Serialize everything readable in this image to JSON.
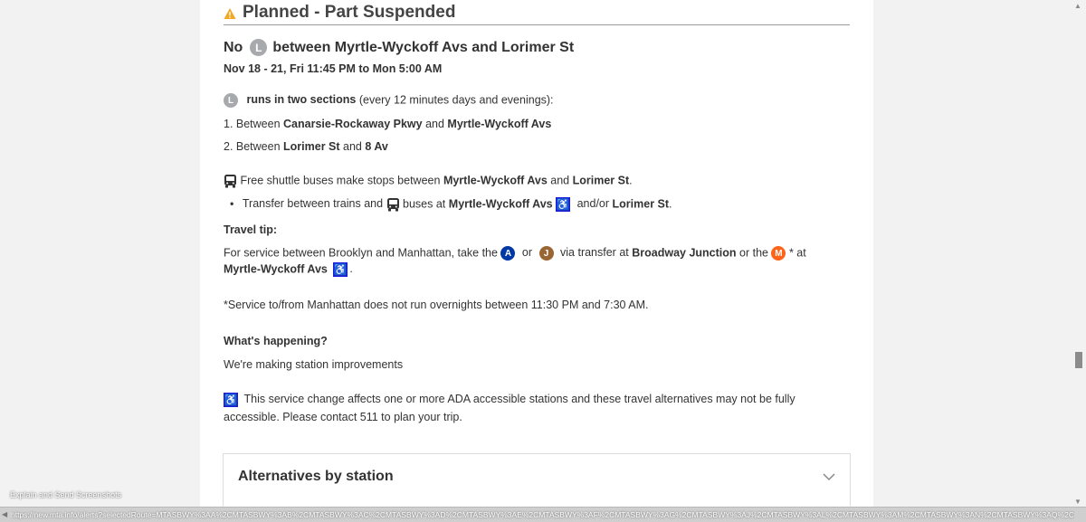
{
  "status": {
    "title": "Planned - Part Suspended",
    "warning_color": "#f5a623"
  },
  "alert": {
    "title_prefix": "No",
    "line": "L",
    "title_suffix": "between Myrtle-Wyckoff Avs and Lorimer St",
    "dates": "Nov 18 - 21, Fri 11:45 PM to Mon 5:00 AM"
  },
  "sections": {
    "runs_bold": "runs in two sections",
    "runs_rest": "(every 12 minutes days and evenings):",
    "item1_prefix": "1. Between",
    "item1_a": "Canarsie-Rockaway Pkwy",
    "item1_and": "and",
    "item1_b": "Myrtle-Wyckoff Avs",
    "item2_prefix": "2. Between",
    "item2_a": "Lorimer St",
    "item2_and": "and",
    "item2_b": "8 Av"
  },
  "shuttle": {
    "text": "Free shuttle buses make stops between",
    "stop_a": "Myrtle-Wyckoff Avs",
    "and": "and",
    "stop_b": "Lorimer St",
    "period": ".",
    "bullet": "•",
    "transfer_text": "Transfer between trains and",
    "buses_at": "buses at",
    "transfer_a": "Myrtle-Wyckoff Avs",
    "andor": "and/or",
    "transfer_b": "Lorimer St"
  },
  "travel_tip": {
    "heading": "Travel tip:",
    "text1": "For service between Brooklyn and Manhattan, take the",
    "line_a": "A",
    "or": "or",
    "line_j": "J",
    "via": "via transfer at",
    "junction": "Broadway Junction",
    "or_the": "or the",
    "line_m": "M",
    "at": "* at",
    "station": "Myrtle-Wyckoff Avs",
    "period": ".",
    "footnote": "*Service to/from Manhattan does not run overnights between 11:30 PM and 7:30 AM."
  },
  "happening": {
    "heading": "What's happening?",
    "text": "We're making station improvements"
  },
  "ada_notice": {
    "line1": "This service change affects one or more ADA accessible stations and these travel alternatives may not be fully",
    "line2": "accessible. Please contact 511 to plan your trip."
  },
  "accordion": {
    "title": "Alternatives by station"
  },
  "browser": {
    "explain": "Explain and Send Screenshots",
    "status_url": "https://new.mta.info/alerts?selectedRoute=MTASBWY%3AA%2CMTASBWY%3AB%2CMTASBWY%3AC%2CMTASBWY%3AD%2CMTASBWY%3AE%2CMTASBWY%3AF%2CMTASBWY%3AG%2CMTASBWY%3AJ%2CMTASBWY%3AL%2CMTASBWY%3AM%2CMTASBWY%3AN%2CMTASBWY%3AQ%2CMTASBWY%3AR%2CMTASBWY%3AW%2CMTASBWY%3AZ"
  }
}
